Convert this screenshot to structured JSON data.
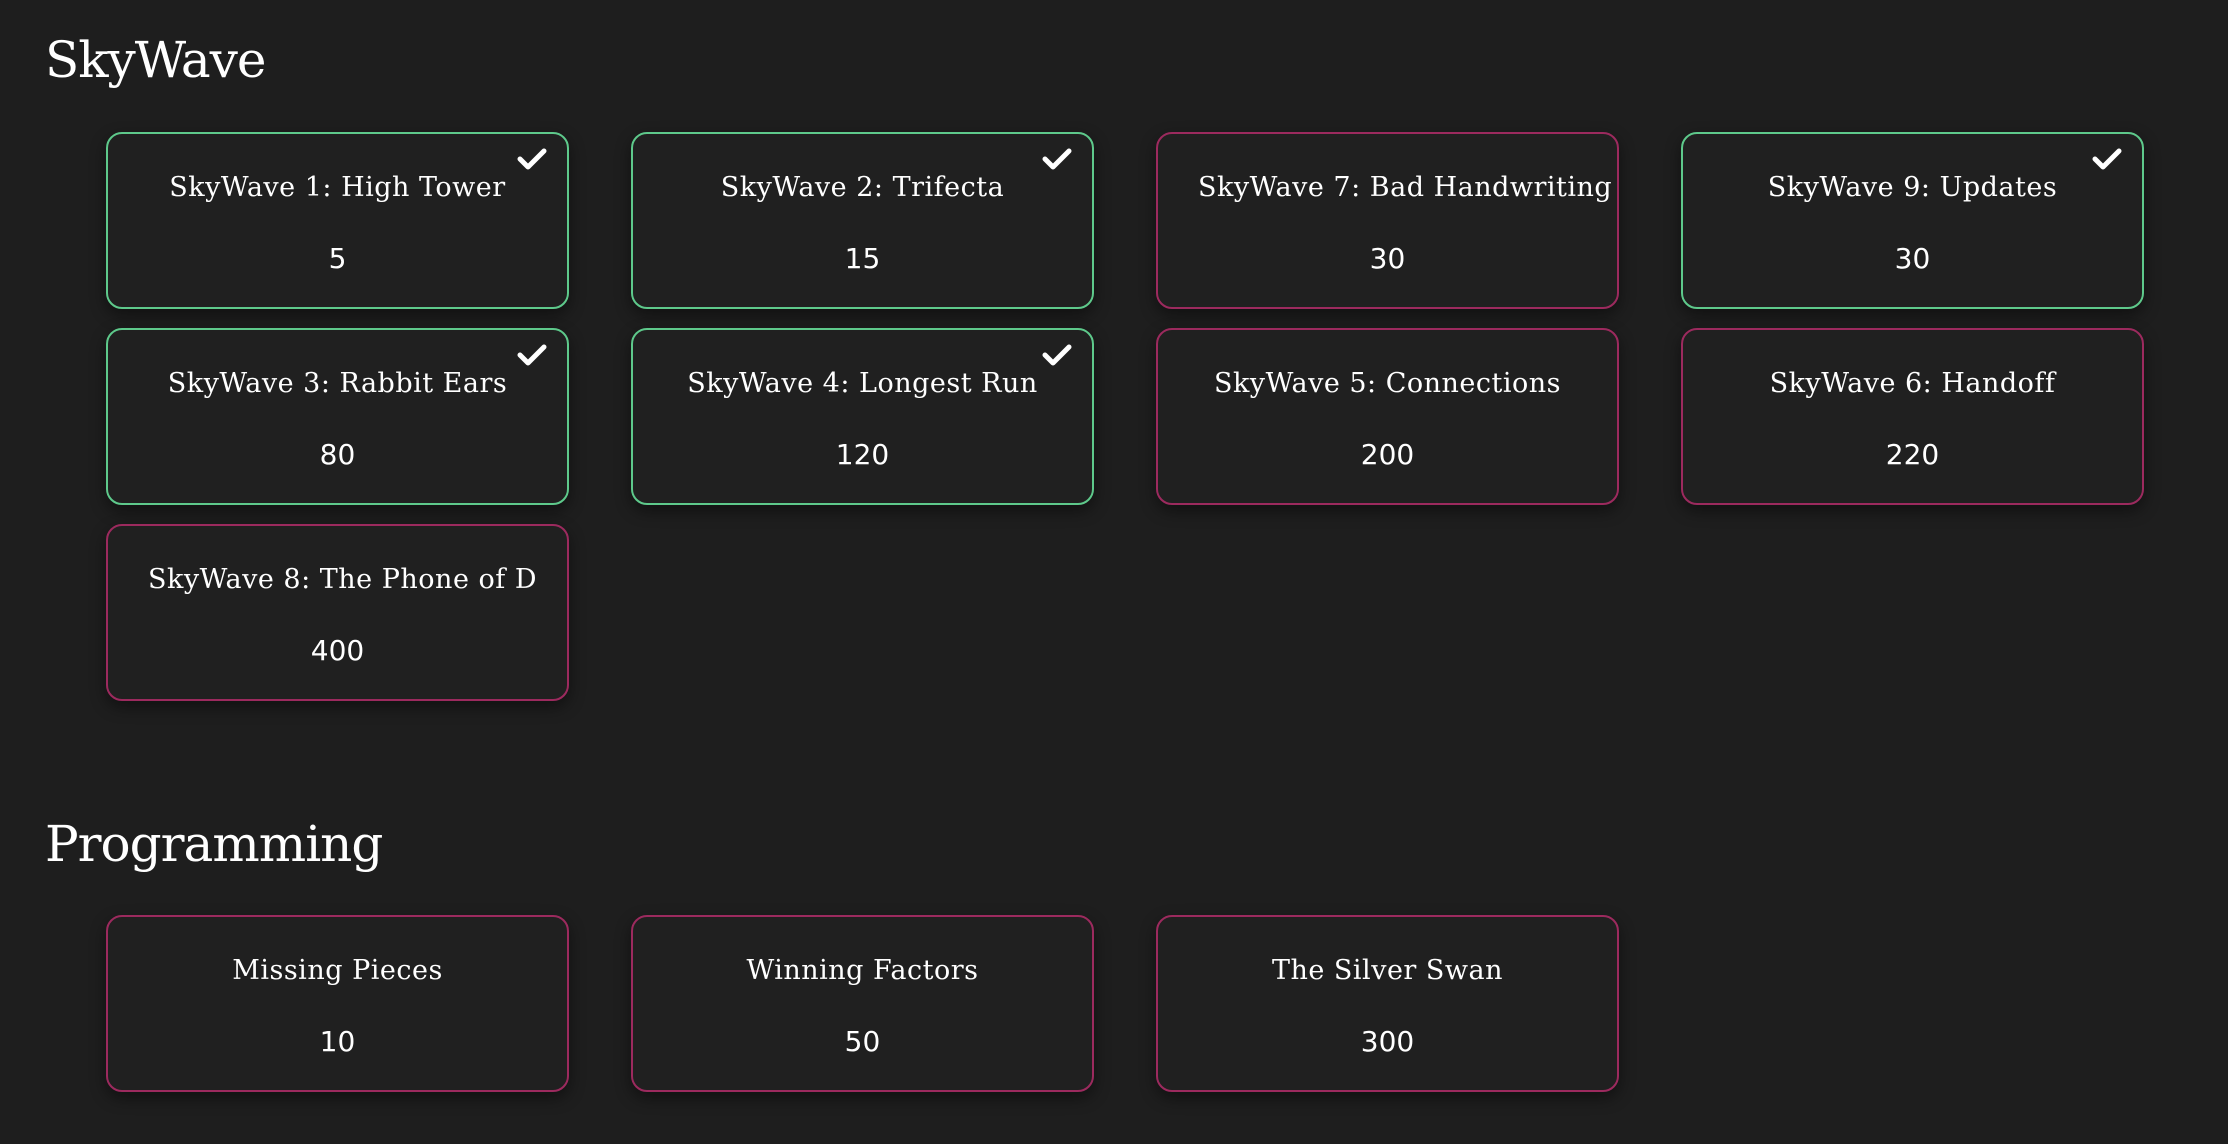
{
  "theme": {
    "background": "#1e1e1e",
    "card_background": "#202020",
    "solved_border": "#5ec98b",
    "unsolved_border": "#9c2a5e",
    "text": "#ffffff"
  },
  "categories": [
    {
      "title": "SkyWave",
      "challenges": [
        {
          "name": "SkyWave 1: High Tower",
          "points": "5",
          "solved": true,
          "icon": "check-icon"
        },
        {
          "name": "SkyWave 2: Trifecta",
          "points": "15",
          "solved": true,
          "icon": "check-icon"
        },
        {
          "name": "SkyWave 7: Bad Handwriting",
          "points": "30",
          "solved": false
        },
        {
          "name": "SkyWave 9: Updates",
          "points": "30",
          "solved": true,
          "icon": "check-icon"
        },
        {
          "name": "SkyWave 3: Rabbit Ears",
          "points": "80",
          "solved": true,
          "icon": "check-icon"
        },
        {
          "name": "SkyWave 4: Longest Run",
          "points": "120",
          "solved": true,
          "icon": "check-icon"
        },
        {
          "name": "SkyWave 5: Connections",
          "points": "200",
          "solved": false
        },
        {
          "name": "SkyWave 6: Handoff",
          "points": "220",
          "solved": false
        },
        {
          "name": "SkyWave 8: The Phone of D",
          "points": "400",
          "solved": false
        }
      ]
    },
    {
      "title": "Programming",
      "challenges": [
        {
          "name": "Missing Pieces",
          "points": "10",
          "solved": false
        },
        {
          "name": "Winning Factors",
          "points": "50",
          "solved": false
        },
        {
          "name": "The Silver Swan",
          "points": "300",
          "solved": false
        }
      ]
    }
  ]
}
